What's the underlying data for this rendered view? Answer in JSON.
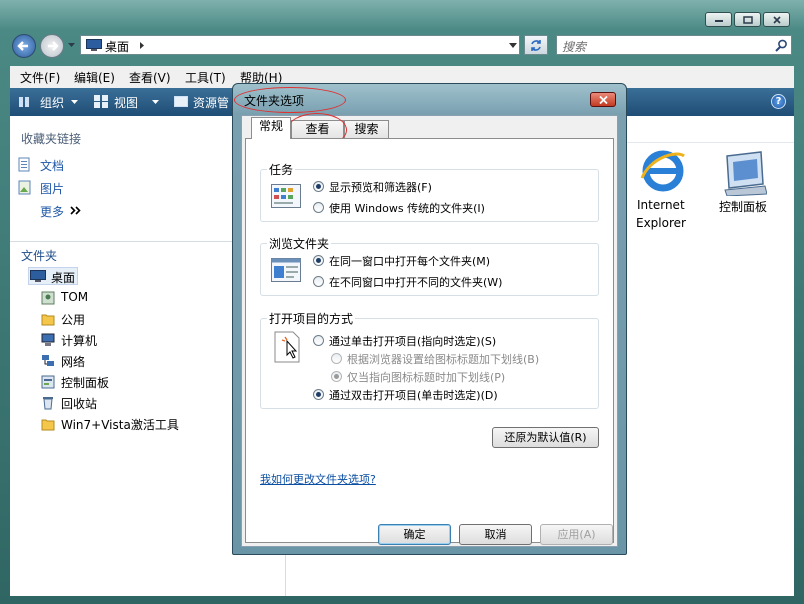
{
  "window": {
    "address": "桌面",
    "search_placeholder": "搜索"
  },
  "menu": [
    "文件(F)",
    "编辑(E)",
    "查看(V)",
    "工具(T)",
    "帮助(H)"
  ],
  "toolbar": {
    "organize": "组织",
    "views": "视图",
    "resources": "资源管"
  },
  "left_pane": {
    "favorites_title": "收藏夹链接",
    "favorites": [
      "文档",
      "图片"
    ],
    "more": "更多",
    "folders_title": "文件夹",
    "tree": [
      "桌面",
      "TOM",
      "公用",
      "计算机",
      "网络",
      "控制面板",
      "回收站",
      "Win7+Vista激活工具"
    ]
  },
  "right_pane": {
    "items": [
      {
        "label_line1": "Internet",
        "label_line2": "Explorer"
      },
      {
        "label_line1": "控制面板",
        "label_line2": ""
      }
    ]
  },
  "dialog": {
    "title": "文件夹选项",
    "tabs": [
      "常规",
      "查看",
      "搜索"
    ],
    "active_tab": "常规",
    "tasks": {
      "label": "任务",
      "options": [
        "显示预览和筛选器(F)",
        "使用 Windows 传统的文件夹(I)"
      ],
      "selected": 0
    },
    "browse": {
      "label": "浏览文件夹",
      "options": [
        "在同一窗口中打开每个文件夹(M)",
        "在不同窗口中打开不同的文件夹(W)"
      ],
      "selected": 0
    },
    "click": {
      "label": "打开项目的方式",
      "single": "通过单击打开项目(指向时选定)(S)",
      "sub1": "根据浏览器设置给图标标题加下划线(B)",
      "sub2": "仅当指向图标标题时加下划线(P)",
      "double": "通过双击打开项目(单击时选定)(D)"
    },
    "restore_button": "还原为默认值(R)",
    "help_link": "我如何更改文件夹选项?",
    "ok": "确定",
    "cancel": "取消",
    "apply": "应用(A)"
  }
}
